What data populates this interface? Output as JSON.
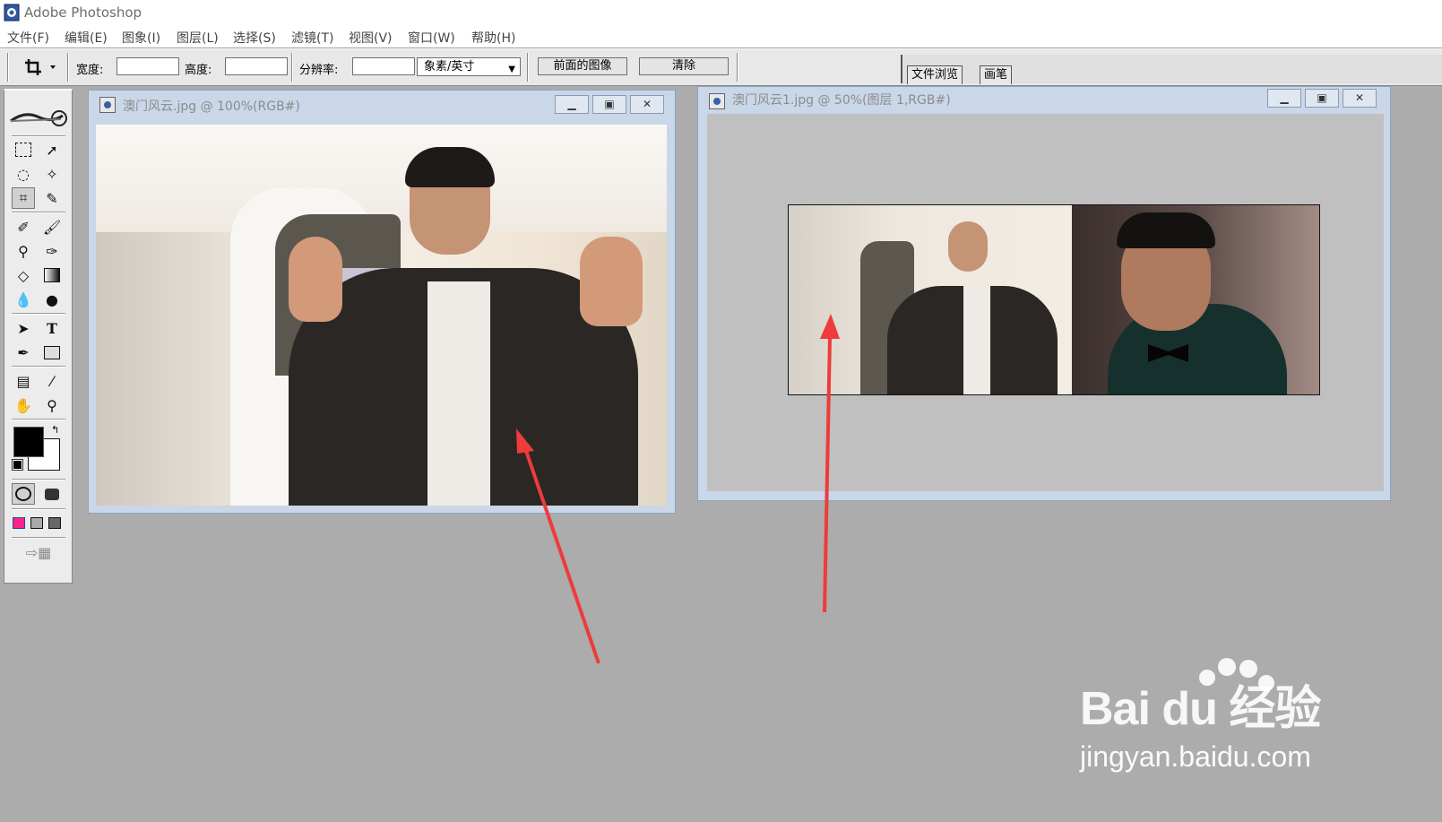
{
  "app": {
    "title": "Adobe Photoshop"
  },
  "menu": [
    "文件(F)",
    "编辑(E)",
    "图象(I)",
    "图层(L)",
    "选择(S)",
    "滤镜(T)",
    "视图(V)",
    "窗口(W)",
    "帮助(H)"
  ],
  "options_bar": {
    "width_label": "宽度:",
    "height_label": "高度:",
    "resolution_label": "分辨率:",
    "unit_value": "象素/英寸",
    "front_image_button": "前面的图像",
    "clear_button": "清除"
  },
  "palette_well": {
    "tabs": [
      "文件浏览",
      "画笔"
    ]
  },
  "doc_window_1": {
    "title": "澳门风云.jpg @ 100%(RGB#)"
  },
  "doc_window_2": {
    "title": "澳门风云1.jpg @ 50%(图层 1,RGB#)"
  },
  "watermark": {
    "brand": "Bai du 经验",
    "url": "jingyan.baidu.com"
  },
  "colors": {
    "annotation_arrow": "#ee3b3b",
    "workspace": "#acacac",
    "window_frame": "#c9d7e8"
  }
}
